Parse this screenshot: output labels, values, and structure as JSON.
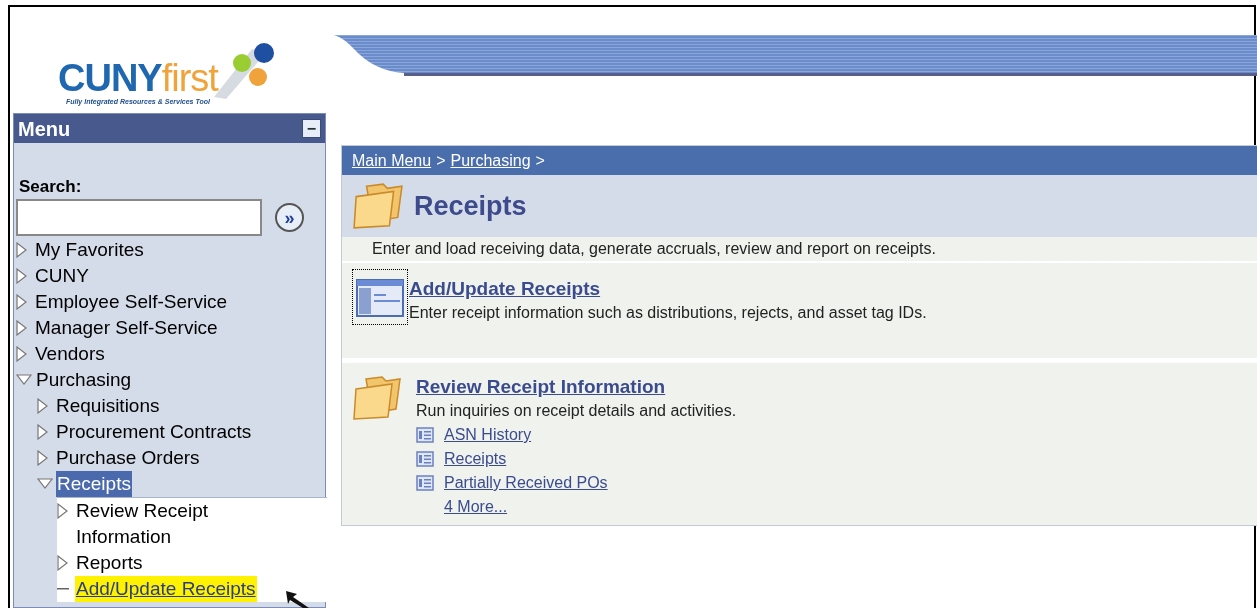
{
  "logo": {
    "wordmark_main": "CUNY",
    "wordmark_accent": "first",
    "tagline": "Fully Integrated Resources & Services Tool"
  },
  "menu": {
    "title": "Menu",
    "collapse_label": "−",
    "search_label": "Search:",
    "go_label": "»",
    "items": [
      {
        "label": "My Favorites",
        "kind": "folder",
        "expanded": false,
        "selected": false
      },
      {
        "label": "CUNY",
        "kind": "folder",
        "expanded": false,
        "selected": false
      },
      {
        "label": "Employee Self-Service",
        "kind": "folder",
        "expanded": false,
        "selected": false
      },
      {
        "label": "Manager Self-Service",
        "kind": "folder",
        "expanded": false,
        "selected": false
      },
      {
        "label": "Vendors",
        "kind": "folder",
        "expanded": false,
        "selected": false
      },
      {
        "label": "Purchasing",
        "kind": "folder",
        "expanded": true,
        "selected": false,
        "children": [
          {
            "label": "Requisitions",
            "kind": "folder",
            "expanded": false,
            "selected": false
          },
          {
            "label": "Procurement Contracts",
            "kind": "folder",
            "expanded": false,
            "selected": false
          },
          {
            "label": "Purchase Orders",
            "kind": "folder",
            "expanded": false,
            "selected": false
          },
          {
            "label": "Receipts",
            "kind": "folder",
            "expanded": true,
            "selected": true,
            "children": [
              {
                "label": "Review Receipt Information",
                "kind": "folder",
                "expanded": false,
                "selected": false
              },
              {
                "label": "Reports",
                "kind": "folder",
                "expanded": false,
                "selected": false
              },
              {
                "label": "Add/Update Receipts",
                "kind": "leaf",
                "selected": false,
                "highlighted": true
              }
            ]
          }
        ]
      }
    ]
  },
  "breadcrumb": [
    {
      "label": "Main Menu"
    },
    {
      "label": "Purchasing"
    }
  ],
  "breadcrumb_separator": ">",
  "page": {
    "title": "Receipts",
    "description": "Enter and load receiving data, generate accruals, review and report on receipts."
  },
  "sections": [
    {
      "kind": "page",
      "title": "Add/Update Receipts",
      "description": "Enter receipt information such as distributions, rejects, and asset tag IDs.",
      "focused": true
    },
    {
      "kind": "folder",
      "title": "Review Receipt Information",
      "description": "Run inquiries on receipt details and activities.",
      "links": [
        {
          "label": "ASN History"
        },
        {
          "label": "Receipts"
        },
        {
          "label": "Partially Received POs"
        }
      ],
      "more": "4 More..."
    }
  ]
}
